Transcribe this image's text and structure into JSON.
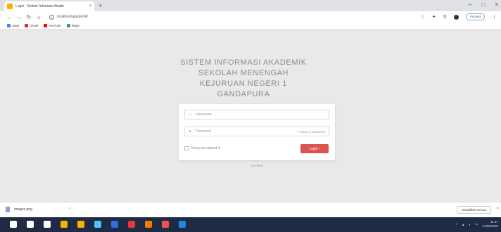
{
  "browser": {
    "tab_title": "Login - Sistem Informasi Akade",
    "tab_close": "×",
    "new_tab": "+",
    "window_controls": [
      "–",
      "□",
      "×"
    ],
    "url": "localhost/akademik/",
    "paused_label": "Paused",
    "bookmarks": [
      {
        "label": "Apps",
        "color": "#4285f4"
      },
      {
        "label": "Gmail",
        "color": "#d93025"
      },
      {
        "label": "YouTube",
        "color": "#ff0000"
      },
      {
        "label": "Maps",
        "color": "#34a853"
      }
    ]
  },
  "page": {
    "title_lines": [
      "SISTEM INFORMASI AKADEMIK",
      "SEKOLAH MENENGAH",
      "KEJURUAN NEGERI 1",
      "GANDAPURA"
    ],
    "username_placeholder": "Username",
    "password_placeholder": "Password",
    "forgot_password": "Forgot ur password",
    "remember_label": "Keep me signed in",
    "login_button": "Login",
    "below_card_text": "[unclear]"
  },
  "downloads": {
    "file_name": "images.png",
    "show_all": "Tampilkan semua",
    "close": "×"
  },
  "taskbar": {
    "time": "11.47",
    "date": "21/05/2020",
    "icon_colors": [
      "#ffffff",
      "#ffffff",
      "#ffffff",
      "#f4b400",
      "#f4b400",
      "#4fc3f7",
      "#2f6fe0",
      "#e53935",
      "#f57c00",
      "#ef5350",
      "#1e88e5"
    ]
  }
}
